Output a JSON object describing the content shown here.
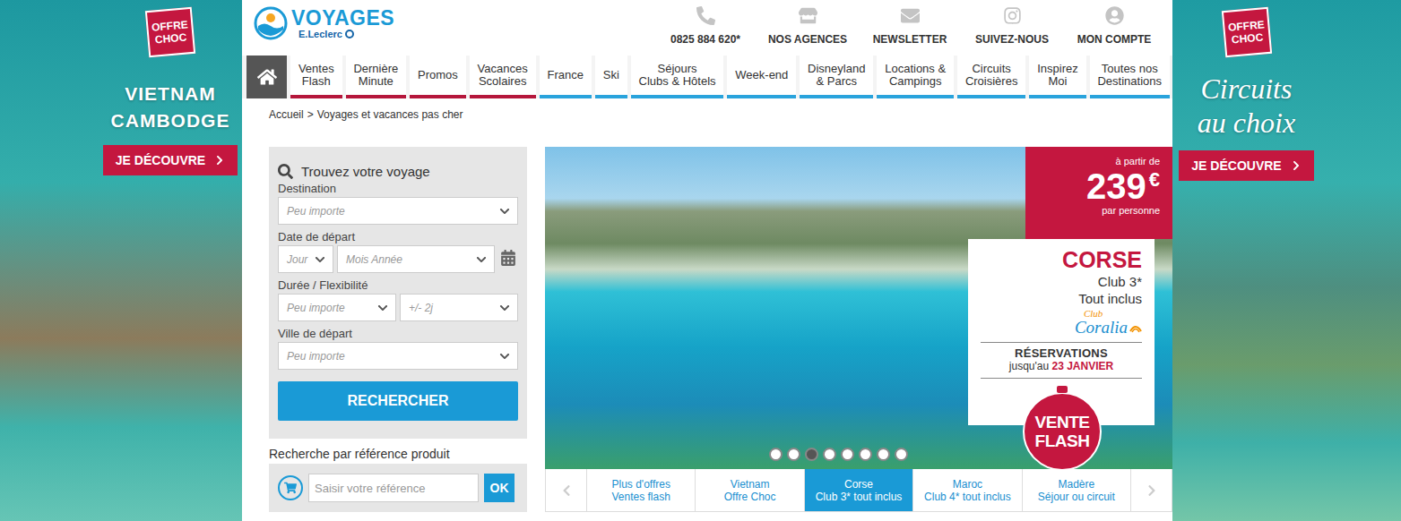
{
  "left_banner": {
    "badge": [
      "OFFRE",
      "CHOC"
    ],
    "title": [
      "VIETNAM",
      "CAMBODGE"
    ],
    "button": "JE DÉCOUVRE"
  },
  "right_banner": {
    "badge": [
      "OFFRE",
      "CHOC"
    ],
    "title": [
      "Circuits",
      "au choix"
    ],
    "button": "JE DÉCOUVRE"
  },
  "logo": {
    "name": "VOYAGES",
    "brand": "E.Leclerc"
  },
  "top_links": [
    {
      "label": "0825 884 620*"
    },
    {
      "label": "NOS AGENCES"
    },
    {
      "label": "NEWSLETTER"
    },
    {
      "label": "SUIVEZ-NOUS"
    },
    {
      "label": "MON COMPTE"
    }
  ],
  "nav": {
    "home": {
      "selected": true
    },
    "tabs": [
      {
        "lines": [
          "Ventes",
          "Flash"
        ],
        "selected": false,
        "color": "#b5163b"
      },
      {
        "lines": [
          "Dernière",
          "Minute"
        ],
        "selected": false,
        "color": "#b5163b"
      },
      {
        "lines": [
          "Promos"
        ],
        "selected": false,
        "color": "#b5163b"
      },
      {
        "lines": [
          "Vacances",
          "Scolaires"
        ],
        "selected": false,
        "color": "#b5163b"
      },
      {
        "lines": [
          "France"
        ],
        "selected": false,
        "color": "#29a3dc"
      },
      {
        "lines": [
          "Ski"
        ],
        "selected": false,
        "color": "#29a3dc"
      },
      {
        "lines": [
          "Séjours",
          "Clubs & Hôtels"
        ],
        "selected": false,
        "color": "#29a3dc"
      },
      {
        "lines": [
          "Week-end"
        ],
        "selected": false,
        "color": "#29a3dc"
      },
      {
        "lines": [
          "Disneyland",
          "& Parcs"
        ],
        "selected": false,
        "color": "#29a3dc"
      },
      {
        "lines": [
          "Locations &",
          "Campings"
        ],
        "selected": false,
        "color": "#29a3dc"
      },
      {
        "lines": [
          "Circuits",
          "Croisières"
        ],
        "selected": false,
        "color": "#29a3dc"
      },
      {
        "lines": [
          "Inspirez",
          "Moi"
        ],
        "selected": false,
        "color": "#29a3dc"
      },
      {
        "lines": [
          "Toutes nos",
          "Destinations"
        ],
        "selected": false,
        "color": "#29a3dc"
      }
    ]
  },
  "breadcrumb": {
    "items": [
      "Accueil",
      "Voyages et vacances pas cher"
    ],
    "separator": ">"
  },
  "search": {
    "title": "Trouvez votre voyage",
    "fields": [
      {
        "label": "Destination",
        "kind": "select",
        "selects": [
          "Peu importe"
        ]
      },
      {
        "label": "Date de départ",
        "kind": "date",
        "selects": [
          "Jour",
          "Mois Année"
        ]
      },
      {
        "label": "Durée / Flexibilité",
        "kind": "select",
        "selects": [
          "Peu importe",
          "+/- 2j"
        ]
      },
      {
        "label": "Ville de départ",
        "kind": "select",
        "selects": [
          "Peu importe"
        ]
      }
    ],
    "button": "RECHERCHER"
  },
  "reference": {
    "title": "Recherche par référence produit",
    "placeholder": "Saisir votre référence",
    "button": "OK"
  },
  "slide": {
    "price_prefix": "à partir de",
    "price": "239",
    "currency": "€",
    "price_suffix": "par personne",
    "destination": "CORSE",
    "lines": [
      "Club 3*",
      "Tout inclus"
    ],
    "brand": {
      "small": "Club",
      "name": "Coralia"
    },
    "booking": {
      "title": "RÉSERVATIONS",
      "prefix": "jusqu'au",
      "date": "23 JANVIER"
    },
    "badge": [
      "VENTE",
      "FLASH"
    ]
  },
  "dots": [
    {
      "selected": false
    },
    {
      "selected": false
    },
    {
      "selected": true
    },
    {
      "selected": false
    },
    {
      "selected": false
    },
    {
      "selected": false
    },
    {
      "selected": false
    },
    {
      "selected": false
    }
  ],
  "slide_tabs": [
    {
      "lines": [
        "Plus d'offres",
        "Ventes flash"
      ],
      "selected": false
    },
    {
      "lines": [
        "Vietnam",
        "Offre Choc"
      ],
      "selected": false
    },
    {
      "lines": [
        "Corse",
        "Club 3* tout inclus"
      ],
      "selected": true
    },
    {
      "lines": [
        "Maroc",
        "Club 4* tout inclus"
      ],
      "selected": false
    },
    {
      "lines": [
        "Madère",
        "Séjour ou circuit"
      ],
      "selected": false
    }
  ]
}
